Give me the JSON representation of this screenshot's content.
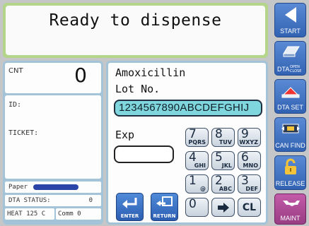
{
  "status": {
    "message": "Ready to dispense"
  },
  "counter": {
    "label": "CNT",
    "value": "0"
  },
  "info": {
    "id_label": "ID:",
    "ticket_label": "TICKET:"
  },
  "footer": {
    "paper_label": "Paper",
    "paper_level": 1,
    "dta_status_label": "DTA STATUS:",
    "dta_status_value": "0",
    "heat_text": "HEAT 125  C",
    "comm_text": "Comm 0"
  },
  "drug": {
    "name": "Amoxicillin",
    "lot_label": "Lot No.",
    "lot_value": "1234567890ABCDEFGHIJ",
    "exp_label": "Exp",
    "exp_value": ""
  },
  "keypad": {
    "keys": [
      {
        "num": "7",
        "sub": "PQRS"
      },
      {
        "num": "8",
        "sub": "TUV"
      },
      {
        "num": "9",
        "sub": "WXYZ"
      },
      {
        "num": "4",
        "sub": "GHI"
      },
      {
        "num": "5",
        "sub": "JKL"
      },
      {
        "num": "6",
        "sub": "MNO"
      },
      {
        "num": "1",
        "sub": "@"
      },
      {
        "num": "2",
        "sub": "ABC"
      },
      {
        "num": "3",
        "sub": "DEF"
      },
      {
        "num": "0",
        "sub": ""
      }
    ],
    "clear_label": "CL",
    "enter_label": "ENTER",
    "return_label": "RETURN"
  },
  "side_buttons": {
    "start": "START",
    "dta_open_close": "DTA",
    "dta_open_close_tag": "OPEN CLOSE",
    "dta_set": "DTA SET",
    "can_find": "CAN FIND",
    "release": "RELEASE",
    "maint": "MAINT"
  },
  "colors": {
    "status_border": "#b4d58a",
    "panel_border": "#a3c4d8",
    "lot_field": "#7fd6dc",
    "side_button": "#3f74c4",
    "maint_button": "#b04f98"
  }
}
